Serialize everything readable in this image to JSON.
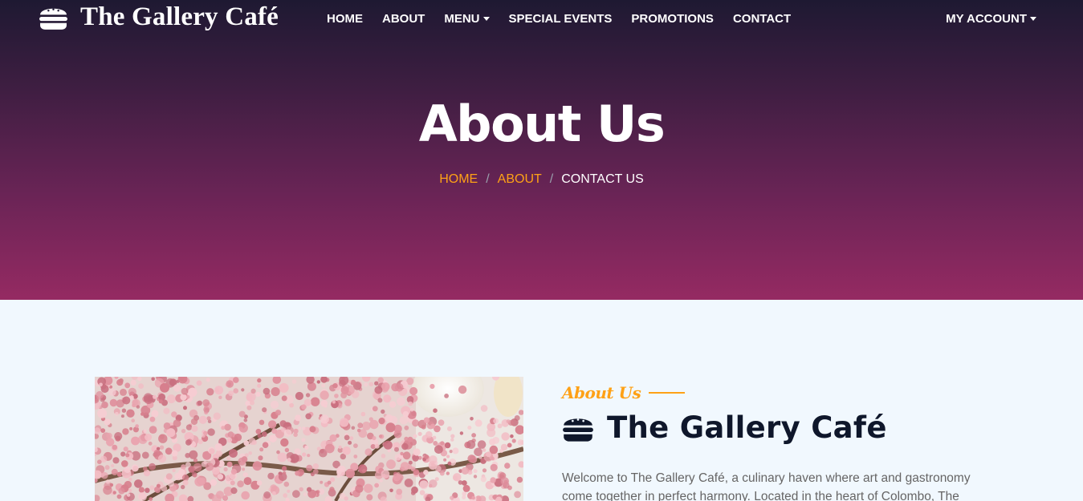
{
  "brand": {
    "name": "The Gallery Café",
    "icon": "hamburger-icon"
  },
  "nav": {
    "items": [
      {
        "label": "HOME",
        "dropdown": false
      },
      {
        "label": "ABOUT",
        "dropdown": false
      },
      {
        "label": "MENU",
        "dropdown": true
      },
      {
        "label": "SPECIAL EVENTS",
        "dropdown": false
      },
      {
        "label": "PROMOTIONS",
        "dropdown": false
      },
      {
        "label": "CONTACT",
        "dropdown": false
      }
    ],
    "account_label": "MY ACCOUNT"
  },
  "hero": {
    "title": "About Us",
    "breadcrumb": {
      "home": "HOME",
      "about": "ABOUT",
      "current": "CONTACT US"
    }
  },
  "about": {
    "tag": "About Us",
    "heading": "The Gallery Café",
    "heading_icon": "hamburger-icon",
    "text": "Welcome to The Gallery Café, a culinary haven where art and gastronomy come together in perfect harmony. Located in the heart of Colombo, The"
  },
  "colors": {
    "accent": "#fea116",
    "dark": "#0f172b",
    "hero_top": "#1e1932",
    "hero_bottom": "#952a62",
    "section_bg": "#f1f8fe"
  }
}
